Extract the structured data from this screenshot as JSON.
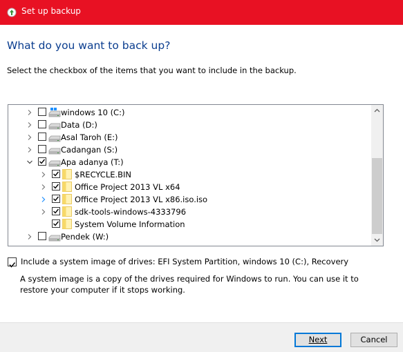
{
  "window": {
    "title": "Set up backup",
    "accent_color": "#e81123"
  },
  "page": {
    "heading": "What do you want to back up?",
    "instruction": "Select the checkbox of the items that you want to include in the backup."
  },
  "tree": {
    "items": [
      {
        "label": "windows 10 (C:)",
        "checked": false,
        "expander": "right",
        "icon": "system-drive-icon"
      },
      {
        "label": "Data (D:)",
        "checked": false,
        "expander": "right",
        "icon": "drive-icon"
      },
      {
        "label": "Asal Taroh (E:)",
        "checked": false,
        "expander": "right",
        "icon": "drive-icon"
      },
      {
        "label": "Cadangan (S:)",
        "checked": false,
        "expander": "right",
        "icon": "drive-icon"
      },
      {
        "label": "Apa adanya (T:)",
        "checked": true,
        "expander": "down",
        "icon": "drive-icon",
        "children": [
          {
            "label": "$RECYCLE.BIN",
            "checked": true,
            "expander": "right",
            "icon": "folder-icon"
          },
          {
            "label": "Office Project 2013 VL x64",
            "checked": true,
            "expander": "right",
            "icon": "folder-icon"
          },
          {
            "label": "Office Project 2013 VL x86.iso.iso",
            "checked": true,
            "expander": "right-highlight",
            "icon": "folder-icon"
          },
          {
            "label": "sdk-tools-windows-4333796",
            "checked": true,
            "expander": "right",
            "icon": "folder-icon"
          },
          {
            "label": "System Volume Information",
            "checked": true,
            "expander": "none",
            "icon": "folder-icon"
          }
        ]
      },
      {
        "label": "Pendek (W:)",
        "checked": false,
        "expander": "right",
        "icon": "drive-icon"
      }
    ]
  },
  "system_image": {
    "checked": true,
    "label": "Include a system image of drives: EFI System Partition, windows 10 (C:), Recovery",
    "description": "A system image is a copy of the drives required for Windows to run. You can use it to restore your computer if it stops working."
  },
  "buttons": {
    "next_label": "Next",
    "cancel_label": "Cancel"
  }
}
